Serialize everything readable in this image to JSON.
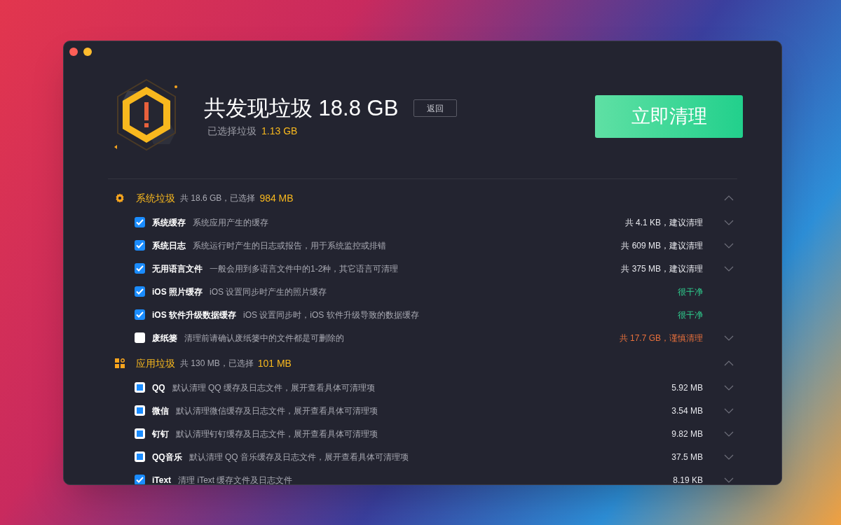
{
  "header": {
    "title": "共发现垃圾 18.8 GB",
    "back_button": "返回",
    "selected_label": "已选择垃圾",
    "selected_value": "1.13 GB",
    "clean_button": "立即清理"
  },
  "sections": [
    {
      "kind": "system",
      "title": "系统垃圾",
      "summary": "共 18.6 GB，已选择",
      "selected": "984 MB",
      "expanded": true,
      "items": [
        {
          "name": "系统缓存",
          "description": "系统应用产生的缓存",
          "status": "共 4.1 KB，建议清理",
          "color": "#e6e7ec",
          "checked": true,
          "partial": false,
          "expandable": true
        },
        {
          "name": "系统日志",
          "description": "系统运行时产生的日志或报告，用于系统监控或排错",
          "status": "共 609 MB，建议清理",
          "color": "#e6e7ec",
          "checked": true,
          "partial": false,
          "expandable": true
        },
        {
          "name": "无用语言文件",
          "description": "一般会用到多语言文件中的1-2种，其它语言可清理",
          "status": "共 375 MB，建议清理",
          "color": "#e6e7ec",
          "checked": true,
          "partial": false,
          "expandable": true
        },
        {
          "name": "iOS 照片缓存",
          "description": "iOS 设置同步时产生的照片缓存",
          "status": "很干净",
          "color": "#2fcf8f",
          "checked": true,
          "partial": false,
          "expandable": false
        },
        {
          "name": "iOS 软件升级数据缓存",
          "description": "iOS 设置同步时，iOS 软件升级导致的数据缓存",
          "status": "很干净",
          "color": "#2fcf8f",
          "checked": true,
          "partial": false,
          "expandable": false
        },
        {
          "name": "废纸篓",
          "description": "清理前请确认废纸篓中的文件都是可删除的",
          "status": "共 17.7 GB，谨慎清理",
          "color": "#e8703c",
          "checked": false,
          "partial": false,
          "expandable": true
        }
      ]
    },
    {
      "kind": "apps",
      "title": "应用垃圾",
      "summary": "共 130 MB，已选择",
      "selected": "101 MB",
      "expanded": true,
      "items": [
        {
          "name": "QQ",
          "description": "默认清理 QQ 缓存及日志文件，展开查看具体可清理项",
          "status": "5.92 MB",
          "color": "#e6e7ec",
          "checked": true,
          "partial": true,
          "expandable": true
        },
        {
          "name": "微信",
          "description": "默认清理微信缓存及日志文件，展开查看具体可清理项",
          "status": "3.54 MB",
          "color": "#e6e7ec",
          "checked": true,
          "partial": true,
          "expandable": true
        },
        {
          "name": "钉钉",
          "description": "默认清理钉钉缓存及日志文件，展开查看具体可清理项",
          "status": "9.82 MB",
          "color": "#e6e7ec",
          "checked": true,
          "partial": true,
          "expandable": true
        },
        {
          "name": "QQ音乐",
          "description": "默认清理 QQ 音乐缓存及日志文件，展开查看具体可清理项",
          "status": "37.5 MB",
          "color": "#e6e7ec",
          "checked": true,
          "partial": true,
          "expandable": true
        },
        {
          "name": "iText",
          "description": "清理 iText 缓存文件及日志文件",
          "status": "8.19 KB",
          "color": "#e6e7ec",
          "checked": true,
          "partial": false,
          "expandable": true
        }
      ]
    }
  ]
}
